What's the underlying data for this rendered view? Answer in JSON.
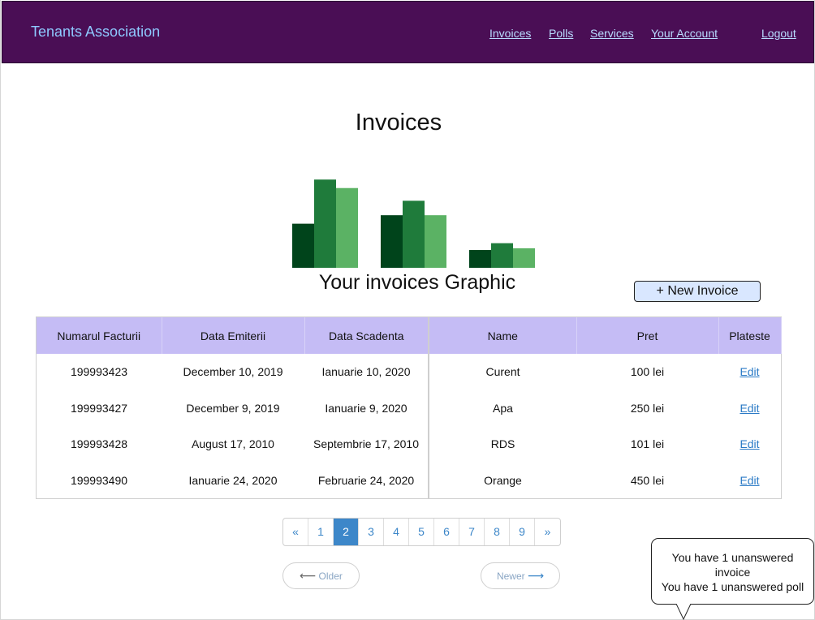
{
  "header": {
    "brand": "Tenants Association",
    "nav": {
      "invoices": "Invoices",
      "polls": "Polls",
      "services": "Services",
      "account": "Your Account",
      "logout": "Logout"
    }
  },
  "main": {
    "title": "Invoices",
    "chart_caption": "Your invoices Graphic",
    "new_invoice_label": "+ New Invoice"
  },
  "chart_data": {
    "type": "bar",
    "categories": [
      "",
      "",
      ""
    ],
    "series": [
      {
        "values": [
          52,
          62,
          21
        ],
        "color": "#00441b"
      },
      {
        "values": [
          104,
          79,
          29
        ],
        "color": "#1f7b3b"
      },
      {
        "values": [
          94,
          62,
          23
        ],
        "color": "#5bb264"
      }
    ],
    "ylim": [
      0,
      110
    ],
    "grid": false,
    "title": "Your invoices Graphic"
  },
  "table": {
    "headers": [
      "Numarul Facturii",
      "Data Emiterii",
      "Data Scadenta",
      "Name",
      "Pret",
      "Plateste"
    ],
    "rows": [
      [
        "199993423",
        "December 10, 2019",
        "Ianuarie 10, 2020",
        "Curent",
        "100 lei",
        "Edit"
      ],
      [
        "199993427",
        "December 9, 2019",
        "Ianuarie 9, 2020",
        "Apa",
        "250 lei",
        "Edit"
      ],
      [
        "199993428",
        "August 17, 2010",
        "Septembrie 17, 2010",
        "RDS",
        "101 lei",
        "Edit"
      ],
      [
        "199993490",
        "Ianuarie 24, 2020",
        "Februarie 24, 2020",
        "Orange",
        "450 lei",
        "Edit"
      ]
    ]
  },
  "pagination": {
    "prev": "«",
    "pages": [
      "1",
      "2",
      "3",
      "4",
      "5",
      "6",
      "7",
      "8",
      "9"
    ],
    "active_page": "2",
    "next": "»",
    "older": "Older",
    "newer": "Newer"
  },
  "notification": {
    "line1": "You have 1 unanswered invoice",
    "line2": "You have 1 unanswered poll"
  }
}
